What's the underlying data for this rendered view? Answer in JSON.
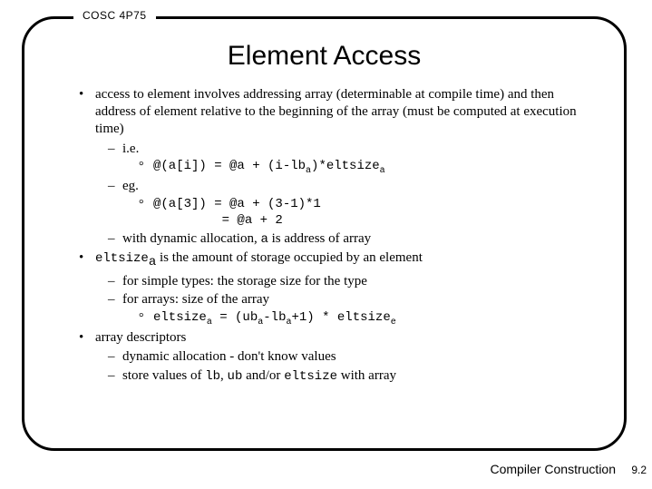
{
  "course": "COSC 4P75",
  "title": "Element Access",
  "footer": "Compiler Construction",
  "page": "9.2",
  "bullets": {
    "b1_1": "access to element involves addressing array (determinable at compile time) and then address of element relative to the beginning of the array (must be computed at execution time)",
    "b2_1": "i.e.",
    "b3_1a": "@(a[i]) = @a + (i-lb",
    "b3_1b": ")*eltsize",
    "b2_2": "eg.",
    "b3_2": "@(a[3]) = @a + (3-1)*1",
    "b3_2cont": "         = @a + 2",
    "b2_3a": "with dynamic allocation, ",
    "b2_3b": " is address of array",
    "b1_2a": "eltsize",
    "b1_2b": " is the amount of storage occupied by an element",
    "b2_4": "for simple types: the storage size for the type",
    "b2_5": "for arrays: size of the array",
    "b3_3a": "eltsize",
    "b3_3b": " = (ub",
    "b3_3c": "-lb",
    "b3_3d": "+1) * eltsize",
    "b1_3": "array descriptors",
    "b2_6": "dynamic allocation - don't know values",
    "b2_7a": "store values of ",
    "b2_7b": ", ",
    "b2_7c": " and/or ",
    "b2_7d": " with array",
    "sub_a": "a",
    "sub_e": "e",
    "code_a": "a",
    "code_lb": "lb",
    "code_ub": "ub",
    "code_eltsize": "eltsize"
  }
}
